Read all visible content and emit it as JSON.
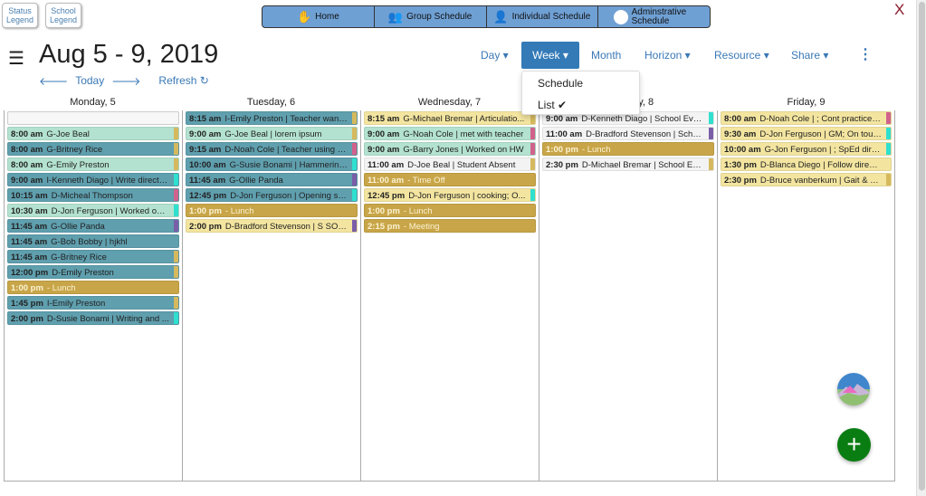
{
  "legends": {
    "status": "Status Legend",
    "school": "School Legend"
  },
  "nav": [
    {
      "label": "Home",
      "icon": "hand-icon"
    },
    {
      "label": "Group Schedule",
      "icon": "group-icon"
    },
    {
      "label": "Individual Schedule",
      "icon": "person-icon"
    },
    {
      "label": "Adminstrative Schedule",
      "icon": "admin-icon"
    }
  ],
  "close": "X",
  "title": "Aug 5 - 9, 2019",
  "subnav": {
    "today": "Today",
    "refresh": "Refresh"
  },
  "toolbar": {
    "day": "Day ▾",
    "week": "Week ▾",
    "month": "Month",
    "horizon": "Horizon ▾",
    "resource": "Resource ▾",
    "share": "Share ▾",
    "more": "⋮"
  },
  "week_dropdown": {
    "options": [
      "Schedule",
      "List ✔"
    ],
    "selected": "List"
  },
  "colors": {
    "mint": "#b3e2d0",
    "teal": "#5f9fae",
    "gold": "#c8a548",
    "yellow": "#f3e5a0",
    "white": "#f3f3f3",
    "s_gold": "#d6b95e",
    "s_pink": "#d0628c",
    "s_cyan": "#2fe0cf",
    "s_purple": "#7a5ea8"
  },
  "days": [
    {
      "label": "Monday, 5",
      "blank": true,
      "events": [
        [
          "8:00 am",
          "G-Joe Beal",
          "mint",
          "s_gold"
        ],
        [
          "8:00 am",
          "G-Britney Rice",
          "teal",
          "s_gold"
        ],
        [
          "8:00 am",
          "G-Emily Preston",
          "mint",
          "s_gold"
        ],
        [
          "9:00 am",
          "I-Kenneth Diago | Write directions",
          "teal",
          "s_cyan"
        ],
        [
          "10:15 am",
          "D-Micheal Thompson",
          "teal",
          "s_pink"
        ],
        [
          "10:30 am",
          "D-Jon Ferguson | Worked on t...",
          "mint",
          "s_cyan"
        ],
        [
          "11:45 am",
          "G-Ollie Panda",
          "teal",
          "s_purple"
        ],
        [
          "11:45 am",
          "G-Bob Bobby | hjkhl",
          "teal",
          ""
        ],
        [
          "11:45 am",
          "G-Britney Rice",
          "teal",
          "s_gold"
        ],
        [
          "12:00 pm",
          "D-Emily Preston",
          "teal",
          "s_gold"
        ],
        [
          "1:00 pm",
          "- Lunch",
          "gold",
          ""
        ],
        [
          "1:45 pm",
          "I-Emily Preston",
          "teal",
          "s_gold"
        ],
        [
          "2:00 pm",
          "D-Susie Bonami | Writing and ...",
          "teal",
          "s_cyan"
        ]
      ]
    },
    {
      "label": "Tuesday, 6",
      "events": [
        [
          "8:15 am",
          "I-Emily Preston | Teacher want...",
          "teal",
          "s_gold"
        ],
        [
          "9:00 am",
          "G-Joe Beal | lorem ipsum",
          "mint",
          "s_gold"
        ],
        [
          "9:15 am",
          "D-Noah Cole | Teacher using d...",
          "teal",
          "s_pink"
        ],
        [
          "10:00 am",
          "G-Susie Bonami | Hammering...",
          "teal",
          "s_cyan"
        ],
        [
          "11:45 am",
          "G-Ollie Panda",
          "teal",
          "s_purple"
        ],
        [
          "12:45 pm",
          "D-Jon Ferguson | Opening se...",
          "teal",
          "s_cyan"
        ],
        [
          "1:00 pm",
          "- Lunch",
          "gold",
          ""
        ],
        [
          "2:00 pm",
          "D-Bradford Stevenson | S SOU...",
          "yellow",
          "s_purple"
        ]
      ]
    },
    {
      "label": "Wednesday, 7",
      "events": [
        [
          "8:15 am",
          "G-Michael Bremar | Articulatio...",
          "yellow",
          "s_gold"
        ],
        [
          "9:00 am",
          "G-Noah Cole | met with teacher",
          "mint",
          "s_pink"
        ],
        [
          "9:00 am",
          "G-Barry Jones | Worked on HW",
          "mint",
          "s_pink"
        ],
        [
          "11:00 am",
          "D-Joe Beal | Student Absent",
          "white",
          "s_gold"
        ],
        [
          "11:00 am",
          "- Time Off",
          "gold",
          ""
        ],
        [
          "12:45 pm",
          "D-Jon Ferguson | cooking; O...",
          "yellow",
          "s_cyan"
        ],
        [
          "1:00 pm",
          "- Lunch",
          "gold",
          ""
        ],
        [
          "2:15 pm",
          "- Meeting",
          "gold",
          ""
        ]
      ]
    },
    {
      "label": "Thursday, 8",
      "events": [
        [
          "9:00 am",
          "D-Kenneth Diago | School Event",
          "white",
          "s_cyan"
        ],
        [
          "11:00 am",
          "D-Bradford Stevenson | Scho...",
          "white",
          "s_purple"
        ],
        [
          "1:00 pm",
          "- Lunch",
          "gold",
          ""
        ],
        [
          "2:30 pm",
          "D-Michael Bremar | School Event",
          "white",
          "s_gold"
        ]
      ]
    },
    {
      "label": "Friday, 9",
      "events": [
        [
          "8:00 am",
          "D-Noah Cole | ; Cont practice d...",
          "yellow",
          "s_pink"
        ],
        [
          "9:30 am",
          "D-Jon Ferguson | GM; On touc...",
          "yellow",
          "s_cyan"
        ],
        [
          "10:00 am",
          "G-Jon Ferguson | ; SpEd direc...",
          "yellow",
          "s_cyan"
        ],
        [
          "1:30 pm",
          "D-Blanca Diego | Follow directi...",
          "yellow",
          ""
        ],
        [
          "2:30 pm",
          "D-Bruce vanberkum | Gait & GM;",
          "yellow",
          "s_gold"
        ]
      ]
    }
  ]
}
